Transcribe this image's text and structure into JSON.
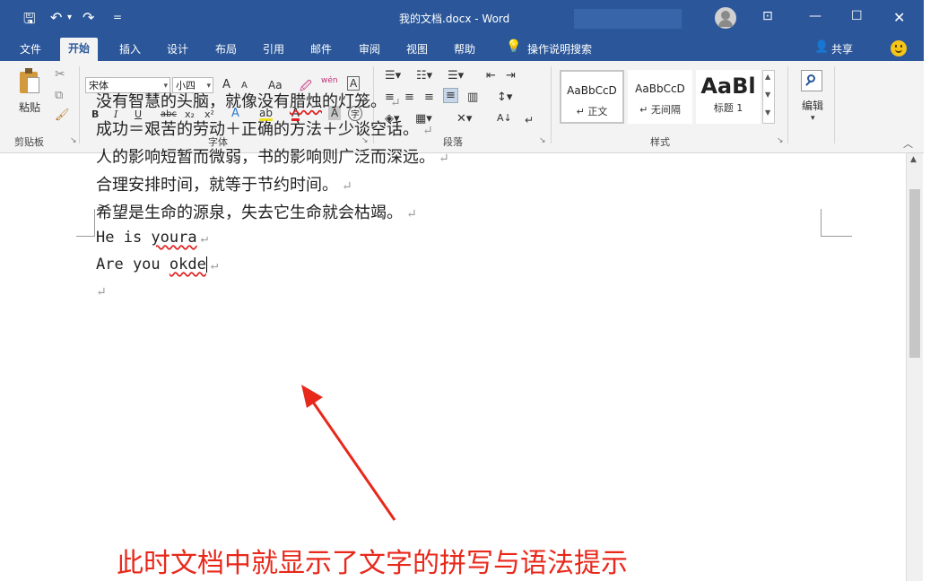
{
  "window": {
    "title": "我的文档.docx  -  Word",
    "controls": {
      "ribbon_display": "⊡",
      "minimize": "—",
      "maximize": "☐",
      "close": "✕"
    }
  },
  "quick_access": {
    "save": "🖫",
    "undo": "↶",
    "undo_dd": "▾",
    "redo": "↷",
    "customize": "="
  },
  "tabs": [
    "文件",
    "开始",
    "插入",
    "设计",
    "布局",
    "引用",
    "邮件",
    "审阅",
    "视图",
    "帮助"
  ],
  "tell_me": "操作说明搜索",
  "share": "共享",
  "ribbon": {
    "clipboard": {
      "paste": "粘贴",
      "group": "剪贴板"
    },
    "font": {
      "name": "宋体",
      "size": "小四",
      "grow": "A",
      "shrink": "A",
      "case": "Aa",
      "clear": "🖉",
      "phonetic": "wén",
      "border": "A",
      "bold": "B",
      "italic": "I",
      "underline": "U",
      "strike": "abc",
      "sub": "x₂",
      "sup": "x²",
      "effects": "A",
      "highlight": "ab",
      "color": "A",
      "shade": "A",
      "enclose": "字",
      "group": "字体"
    },
    "paragraph": {
      "group": "段落",
      "sort": "A↓",
      "marks": "↵"
    },
    "styles": {
      "items": [
        {
          "preview": "AaBbCcD",
          "name": "↵ 正文"
        },
        {
          "preview": "AaBbCcD",
          "name": "↵ 无间隔"
        },
        {
          "preview": "AaBl",
          "name": "标题 1"
        }
      ],
      "group": "样式"
    },
    "editing": {
      "label": "编辑",
      "dd": "▾"
    }
  },
  "document": {
    "lines": [
      {
        "pre": "没有智慧的头脑，就像没有",
        "err": "腊烛",
        "post": "的灯笼。"
      },
      {
        "pre": "成功＝艰苦的劳动＋正确的方法＋少谈空话。",
        "err": "",
        "post": ""
      },
      {
        "pre": "人的影响短暂而微弱，书的影响则广泛而深远。",
        "err": "",
        "post": ""
      },
      {
        "pre": "合理安排时间，就等于节约时间。",
        "err": "",
        "post": ""
      },
      {
        "pre": "希望是生命的源泉，失去它生命就会枯竭。",
        "err": "",
        "post": ""
      },
      {
        "pre": "He is ",
        "err": "youra",
        "post": ""
      },
      {
        "pre": "Are you ",
        "err": "okde",
        "post": ""
      }
    ],
    "paragraph_mark": "↵"
  },
  "annotation": {
    "caption": "此时文档中就显示了文字的拼写与语法提示",
    "color": "#e8281b"
  },
  "colors": {
    "accent": "#2b579a",
    "ribbon_bg": "#f3f3f3",
    "spell_error": "#e02020"
  }
}
